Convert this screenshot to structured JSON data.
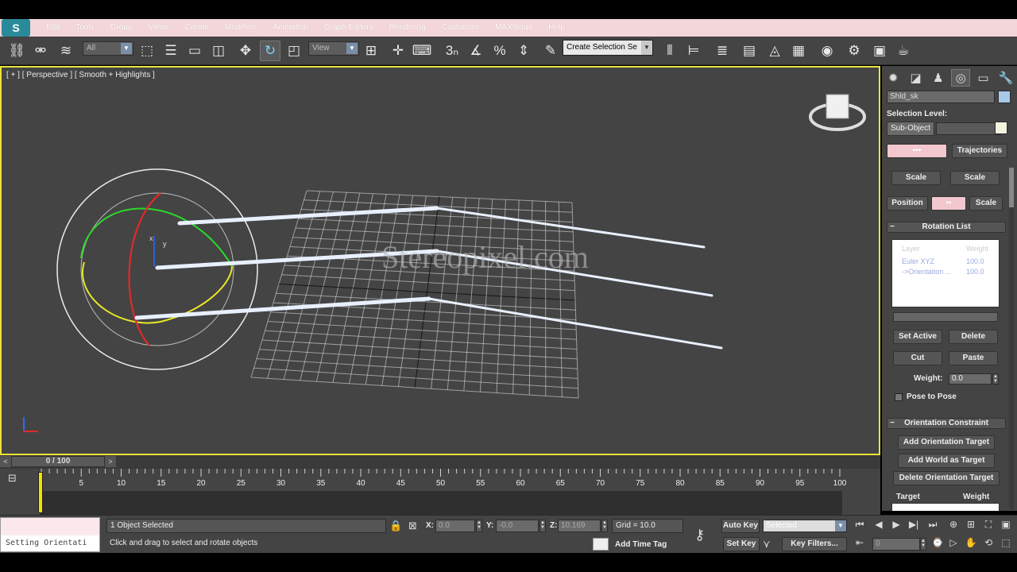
{
  "app": {
    "logo_text": "S"
  },
  "menu": {
    "items": [
      "Edit",
      "Tools",
      "Group",
      "Views",
      "Create",
      "Modifiers",
      "Animation",
      "Graph Editors",
      "Rendering",
      "Customize",
      "MAXScript",
      "Help"
    ]
  },
  "toolbar": {
    "filter_value": "All",
    "ref_coord_value": "View",
    "selection_set_value": "Create Selection Se",
    "snap_label": "3",
    "angle_snap_label": "%"
  },
  "viewport": {
    "label": "[ + ] [ Perspective ] [ Smooth + Highlights ]",
    "watermark": "Stereopixel.com",
    "axis_x": "x",
    "axis_y": "y"
  },
  "command_panel": {
    "object_name": "Shld_sk",
    "selection_level_label": "Selection Level:",
    "sub_object_label": "Sub-Object",
    "tab_trajectories": "Trajectories",
    "btn_scale_1": "Scale",
    "btn_scale_2": "Scale",
    "btn_position": "Position",
    "btn_scale_3": "Scale",
    "rotation_list": {
      "header": "Rotation List",
      "col_layer": "Layer",
      "col_weight": "Weight",
      "rows": [
        {
          "layer": "Euler XYZ",
          "weight": "100.0"
        },
        {
          "layer": "->Orientation ...",
          "weight": "100.0"
        }
      ],
      "set_active": "Set Active",
      "delete": "Delete",
      "cut": "Cut",
      "paste": "Paste",
      "weight_label": "Weight:",
      "weight_value": "0.0",
      "pose_to_pose": "Pose to Pose"
    },
    "orientation_constraint": {
      "header": "Orientation Constraint",
      "add_target": "Add Orientation Target",
      "add_world": "Add World as Target",
      "delete_target": "Delete Orientation Target",
      "col_target": "Target",
      "col_weight": "Weight"
    }
  },
  "time_slider": {
    "frame": "0 / 100"
  },
  "track_bar": {
    "ticks": [
      "5",
      "10",
      "15",
      "20",
      "25",
      "30",
      "35",
      "40",
      "45",
      "50",
      "55",
      "60",
      "65",
      "70",
      "75",
      "80",
      "85",
      "90",
      "95",
      "100"
    ]
  },
  "status": {
    "maxscript_output": "Setting Orientati",
    "selected": "1 Object Selected",
    "prompt": "Click and drag to select and rotate objects",
    "x_label": "X:",
    "x_value": "0.0",
    "y_label": "Y:",
    "y_value": "-0.0",
    "z_label": "Z:",
    "z_value": "10.169",
    "grid": "Grid = 10.0",
    "add_time_tag": "Add Time Tag",
    "auto_key": "Auto Key",
    "auto_key_mode": "Selected",
    "set_key": "Set Key",
    "key_filters": "Key Filters...",
    "current_frame": "0"
  },
  "colors": {
    "viewport_border": "#ebe33a",
    "menu_bg": "#f3d6da",
    "ui_bg": "#444444"
  }
}
